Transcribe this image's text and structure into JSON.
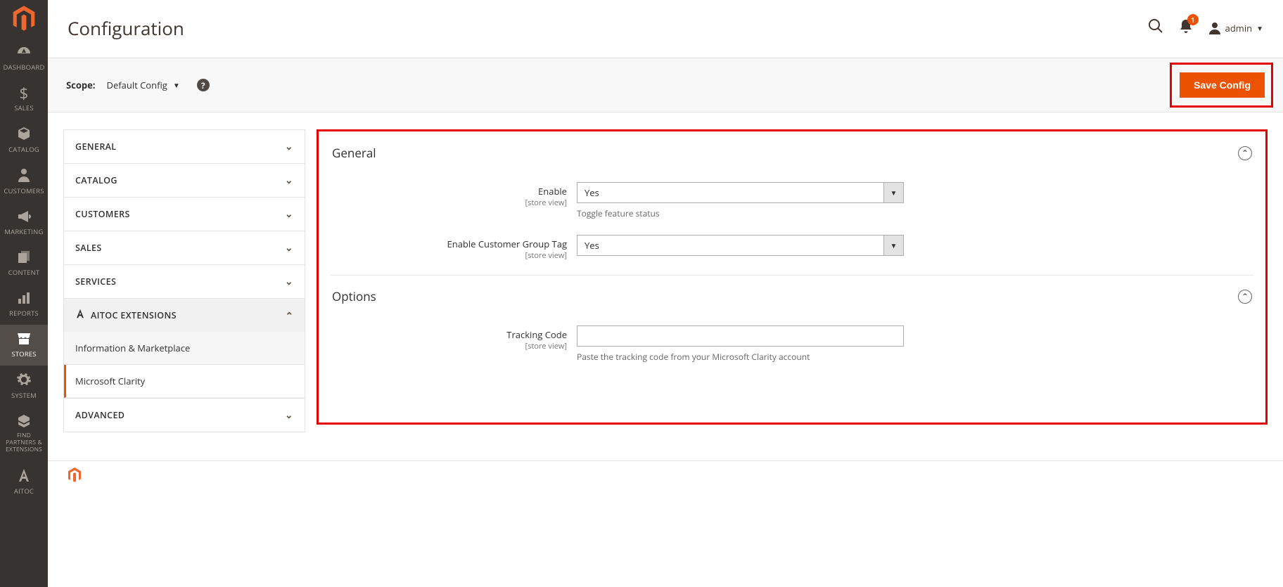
{
  "sidebar": {
    "items": [
      {
        "label": "DASHBOARD"
      },
      {
        "label": "SALES"
      },
      {
        "label": "CATALOG"
      },
      {
        "label": "CUSTOMERS"
      },
      {
        "label": "MARKETING"
      },
      {
        "label": "CONTENT"
      },
      {
        "label": "REPORTS"
      },
      {
        "label": "STORES"
      },
      {
        "label": "SYSTEM"
      },
      {
        "label": "FIND PARTNERS & EXTENSIONS"
      },
      {
        "label": "AITOC"
      }
    ]
  },
  "header": {
    "title": "Configuration",
    "notification_count": "1",
    "user": "admin"
  },
  "scope": {
    "label": "Scope:",
    "value": "Default Config"
  },
  "actions": {
    "save": "Save Config"
  },
  "config_nav": {
    "sections": [
      {
        "label": "GENERAL"
      },
      {
        "label": "CATALOG"
      },
      {
        "label": "CUSTOMERS"
      },
      {
        "label": "SALES"
      },
      {
        "label": "SERVICES"
      },
      {
        "label": "AITOC EXTENSIONS",
        "expanded": true,
        "items": [
          {
            "label": "Information & Marketplace"
          },
          {
            "label": "Microsoft Clarity",
            "active": true
          }
        ]
      },
      {
        "label": "ADVANCED"
      }
    ]
  },
  "panel": {
    "general": {
      "title": "General",
      "fields": {
        "enable": {
          "label": "Enable",
          "scope": "[store view]",
          "value": "Yes",
          "note": "Toggle feature status"
        },
        "customer_group": {
          "label": "Enable Customer Group Tag",
          "scope": "[store view]",
          "value": "Yes"
        }
      }
    },
    "options": {
      "title": "Options",
      "fields": {
        "tracking": {
          "label": "Tracking Code",
          "scope": "[store view]",
          "value": "",
          "note": "Paste the tracking code from your Microsoft Clarity account"
        }
      }
    }
  }
}
